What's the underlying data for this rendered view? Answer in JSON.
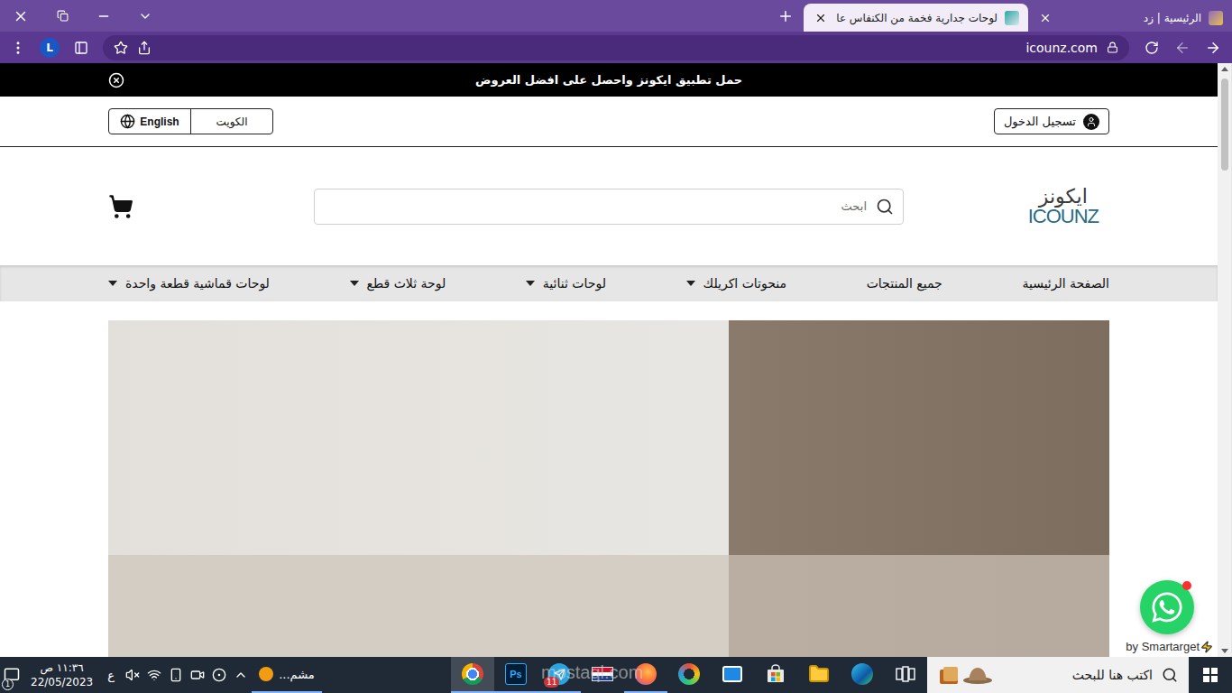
{
  "browser": {
    "tabs": [
      {
        "title": "الرئيسية | زد",
        "selected": false
      },
      {
        "title": "لوحات جدارية فخمة من الكنفاس عا",
        "selected": true
      }
    ],
    "url": "icounz.com",
    "profile": "L",
    "back_enabled": true,
    "forward_enabled": false
  },
  "page": {
    "announcement": "حمل تطبيق ايكونز واحصل على افضل العروض",
    "login": "تسجيل الدخول",
    "country": "الكويت",
    "language": "English",
    "logo": {
      "arabic": "ايكونز",
      "latin": "ICOUNZ"
    },
    "search": {
      "placeholder": "ابحث"
    },
    "nav": [
      {
        "label": "الصفحة الرئيسية",
        "dropdown": false
      },
      {
        "label": "جميع المنتجات",
        "dropdown": false
      },
      {
        "label": "منحوتات اكريلك",
        "dropdown": true
      },
      {
        "label": "لوحات ثنائية",
        "dropdown": true
      },
      {
        "label": "لوحة ثلاث قطع",
        "dropdown": true
      },
      {
        "label": "لوحات قماشية قطعة واحدة",
        "dropdown": true
      }
    ],
    "whatsapp": {
      "unread": true
    },
    "credit": "by Smartarget"
  },
  "taskbar": {
    "search": {
      "placeholder": "اكتب هنا للبحث"
    },
    "apps": [
      {
        "kind": "task-view",
        "active": false,
        "running": false
      },
      {
        "kind": "edge",
        "active": false,
        "running": false
      },
      {
        "kind": "explorer",
        "active": false,
        "running": false
      },
      {
        "kind": "store",
        "active": false,
        "running": false
      },
      {
        "kind": "mail",
        "active": false,
        "running": false
      },
      {
        "kind": "vpn",
        "active": false,
        "running": false
      },
      {
        "kind": "firefox",
        "active": false,
        "running": true
      },
      {
        "kind": "flag",
        "active": false,
        "running": false
      },
      {
        "kind": "telegram",
        "active": false,
        "running": true,
        "badge": "11"
      },
      {
        "kind": "photoshop",
        "active": false,
        "running": true,
        "label": "Ps"
      },
      {
        "kind": "chrome",
        "active": true,
        "running": true
      }
    ],
    "running_item": {
      "label": "مشم..."
    },
    "volume_muted": true,
    "input_language": "ع",
    "time": "١١:٣٦ ص",
    "date": "22/05/2023",
    "notification_count": "1",
    "watermark": "mostaql.com"
  }
}
